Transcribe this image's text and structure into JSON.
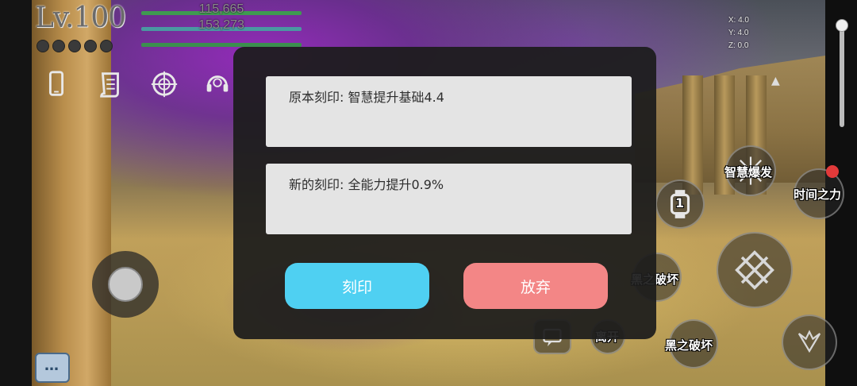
{
  "hud": {
    "level": "Lv.100",
    "hp_value": "115,665",
    "mp_value": "153,273",
    "coords": {
      "x": "X: 4.0",
      "y": "Y: 4.0",
      "z": "Z: 0.0"
    }
  },
  "top_icons": [
    "phone-icon",
    "scroll-icon",
    "crosshair-icon",
    "headset-icon"
  ],
  "modal": {
    "original_engraving": "原本刻印: 智慧提升基础4.4",
    "new_engraving": "新的刻印: 全能力提升0.9%",
    "engrave_label": "刻印",
    "discard_label": "放弃"
  },
  "skills": {
    "wisdom_burst": "智慧爆发",
    "time_power": "时间之力",
    "black_break_1": "黑之破坏",
    "black_break_2": "黑之破坏",
    "leave": "离开",
    "slot_number": "1"
  },
  "colors": {
    "engrave_button": "#4fd0f2",
    "discard_button": "#f38686",
    "hp_bar": "#3f9a50",
    "mp_bar": "#4a98a2"
  }
}
